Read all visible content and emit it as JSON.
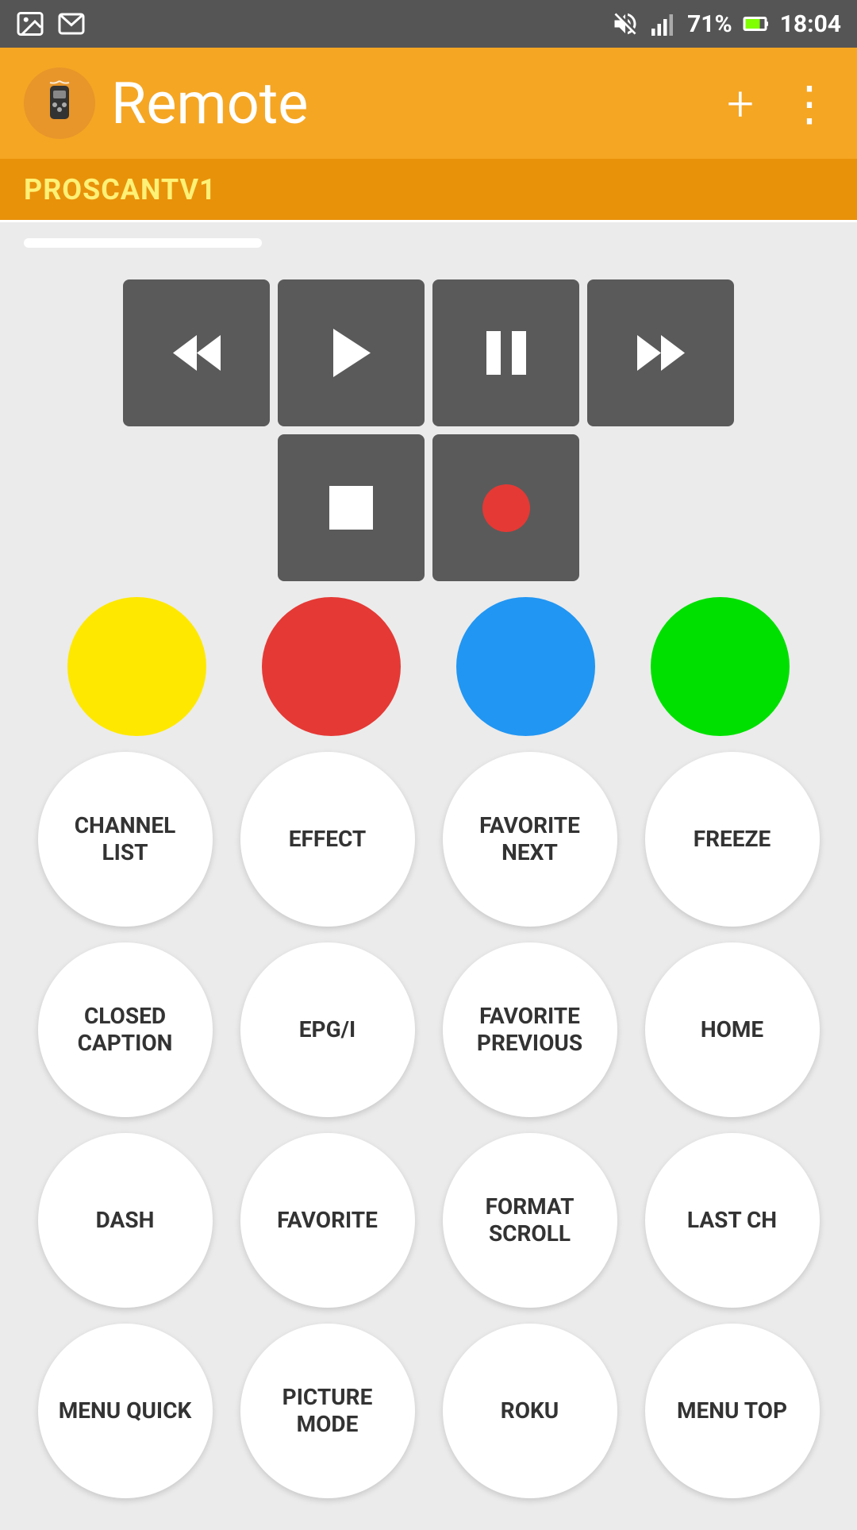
{
  "statusBar": {
    "time": "18:04",
    "battery": "71%",
    "icons": [
      "gallery",
      "mail",
      "mute",
      "signal",
      "battery"
    ]
  },
  "appBar": {
    "title": "Remote",
    "addLabel": "+",
    "menuLabel": "⋮",
    "iconSymbol": "📱"
  },
  "tabBar": {
    "label": "PROSCANTV1"
  },
  "transportButtons": {
    "rewind": "⏪",
    "play": "▶",
    "pause": "⏸",
    "fastForward": "⏩",
    "stop": "■",
    "record": "●"
  },
  "colorButtons": [
    {
      "id": "yellow",
      "color": "#FFE800"
    },
    {
      "id": "red",
      "color": "#E53935"
    },
    {
      "id": "blue",
      "color": "#2196F3"
    },
    {
      "id": "green",
      "color": "#00E000"
    }
  ],
  "remoteButtons": [
    "CHANNEL LIST",
    "EFFECT",
    "FAVORITE NEXT",
    "FREEZE",
    "CLOSED CAPTION",
    "EPG/I",
    "FAVORITE PREVIOUS",
    "HOME",
    "DASH",
    "FAVORITE",
    "FORMAT SCROLL",
    "LAST CH",
    "MENU QUICK",
    "PICTURE MODE",
    "ROKU",
    "MENU TOP"
  ]
}
